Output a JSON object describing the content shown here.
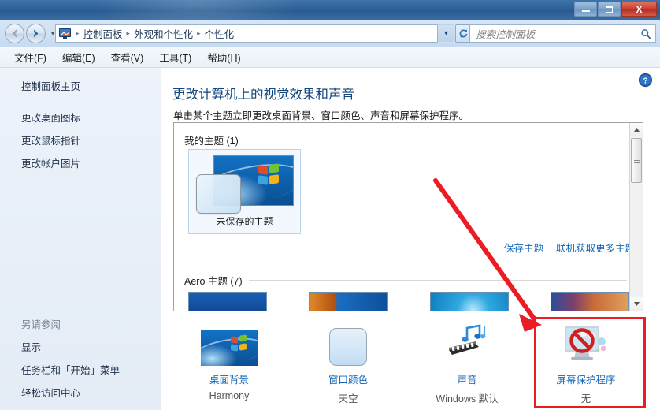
{
  "window": {
    "minimize_label": "—",
    "maximize_label": "□",
    "close_label": "X"
  },
  "nav": {
    "back_icon": "back-arrow-icon",
    "forward_icon": "forward-arrow-icon",
    "history_chevron": "▾",
    "breadcrumb_icon": "control-panel-icon",
    "crumbs": [
      "控制面板",
      "外观和个性化",
      "个性化"
    ],
    "separator": "▸",
    "dropdown_chevron": "▾",
    "path_dropdown": "▾",
    "refresh_icon": "refresh-icon"
  },
  "search": {
    "placeholder": "搜索控制面板",
    "icon": "search-icon"
  },
  "menu": {
    "items": [
      "文件(F)",
      "编辑(E)",
      "查看(V)",
      "工具(T)",
      "帮助(H)"
    ]
  },
  "sidebar": {
    "home": "控制面板主页",
    "items": [
      "更改桌面图标",
      "更改鼠标指针",
      "更改帐户图片"
    ],
    "see_also_header": "另请参阅",
    "see_also": [
      "显示",
      "任务栏和「开始」菜单",
      "轻松访问中心"
    ]
  },
  "content": {
    "help_icon": "help-icon",
    "heading": "更改计算机上的视觉效果和声音",
    "subtitle": "单击某个主题立即更改桌面背景、窗口颜色、声音和屏幕保护程序。",
    "my_themes_header": "我的主题 (1)",
    "my_theme_tile_label": "未保存的主题",
    "save_theme_link": "保存主题",
    "get_more_themes_link": "联机获取更多主题",
    "aero_themes_header": "Aero 主题 (7)",
    "scrollbar": {
      "up_arrow": "▲",
      "down_arrow": "▼"
    }
  },
  "settings_row": [
    {
      "label": "桌面背景",
      "value": "Harmony",
      "icon": "desktop-background-icon"
    },
    {
      "label": "窗口颜色",
      "value": "天空",
      "icon": "window-color-icon"
    },
    {
      "label": "声音",
      "value": "Windows 默认",
      "icon": "sound-icon"
    },
    {
      "label": "屏幕保护程序",
      "value": "无",
      "icon": "screen-saver-icon"
    }
  ],
  "annotation": {
    "color": "#ec1c24",
    "highlight_target": "屏幕保护程序",
    "arrow_icon": "red-arrow-annotation",
    "box_icon": "red-highlight-box"
  }
}
